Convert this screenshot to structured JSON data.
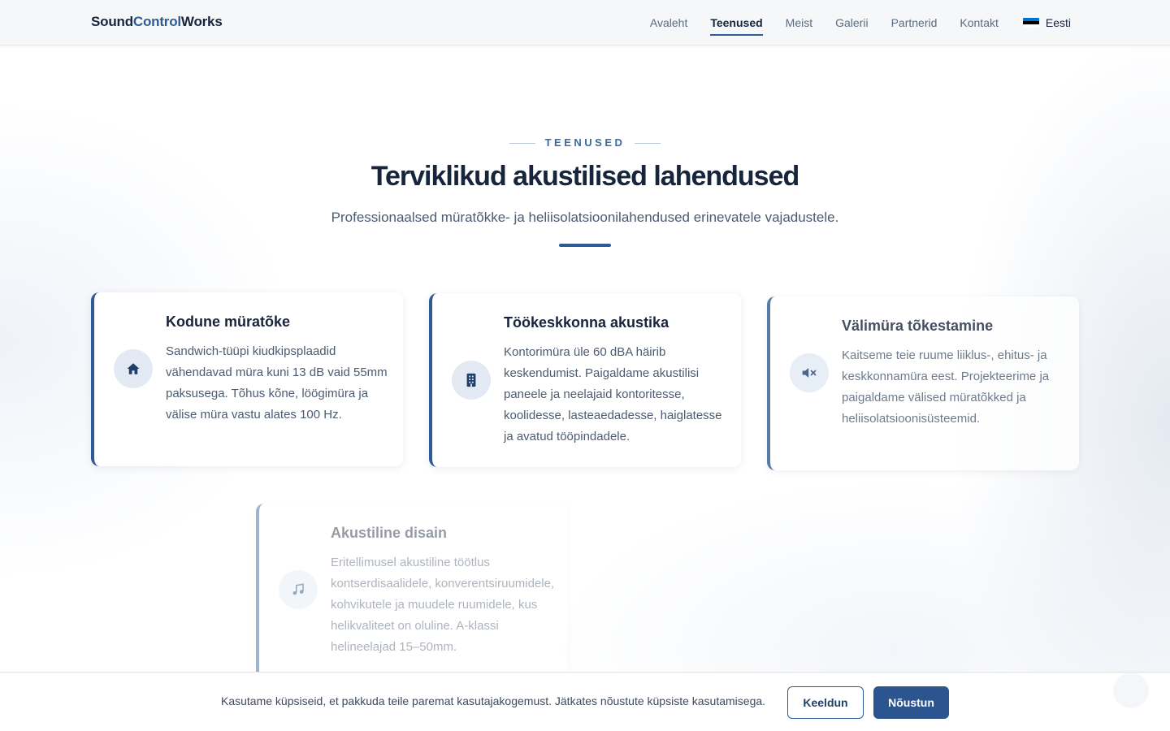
{
  "brand": {
    "part1": "Sound",
    "part2": "Control",
    "part3": "Works"
  },
  "nav": {
    "items": [
      {
        "label": "Avaleht",
        "active": false
      },
      {
        "label": "Teenused",
        "active": true
      },
      {
        "label": "Meist",
        "active": false
      },
      {
        "label": "Galerii",
        "active": false
      },
      {
        "label": "Partnerid",
        "active": false
      },
      {
        "label": "Kontakt",
        "active": false
      }
    ],
    "language": {
      "label": "Eesti",
      "flag_colors": [
        "#0072ce",
        "#000000",
        "#ffffff"
      ]
    }
  },
  "section": {
    "eyebrow": "TEENUSED",
    "title": "Terviklikud akustilised lahendused",
    "subtitle": "Professionaalsed müratõkke- ja heliisolatsioonilahendused erinevatele vajadustele."
  },
  "cards": [
    {
      "icon": "home-icon",
      "title": "Kodune müratõke",
      "text": "Sandwich-tüüpi kiudkipsplaadid vähendavad müra kuni 13 dB vaid 55mm paksusega. Tõhus kõne, löögimüra ja välise müra vastu alates 100 Hz."
    },
    {
      "icon": "building-icon",
      "title": "Töökeskkonna akustika",
      "text": "Kontorimüra üle 60 dBA häirib keskendumist. Paigaldame akustilisi paneele ja neelajaid kontoritesse, koolidesse, lasteaedadesse, haiglatesse ja avatud tööpindadele."
    },
    {
      "icon": "volume-mute-icon",
      "title": "Välimüra tõkestamine",
      "text": "Kaitseme teie ruume liiklus-, ehitus- ja keskkonnamüra eest. Projekteerime ja paigaldame välised müratõkked ja heliisolatsioonisüsteemid."
    },
    {
      "icon": "music-note-icon",
      "title": "Akustiline disain",
      "text": "Eritellimusel akustiline töötlus kontserdisaalidele, konverentsiruumidele, kohvikutele ja muudele ruumidele, kus helikvaliteet on oluline. A-klassi helineelajad 15–50mm."
    }
  ],
  "cookie": {
    "text": "Kasutame küpsiseid, et pakkuda teile paremat kasutajakogemust. Jätkates nõustute küpsiste kasutamisega.",
    "decline_label": "Keeldun",
    "accept_label": "Nõustun"
  },
  "colors": {
    "primary": "#2e5b94",
    "heading": "#16243c",
    "icon_bg": "#e3eaf4"
  }
}
